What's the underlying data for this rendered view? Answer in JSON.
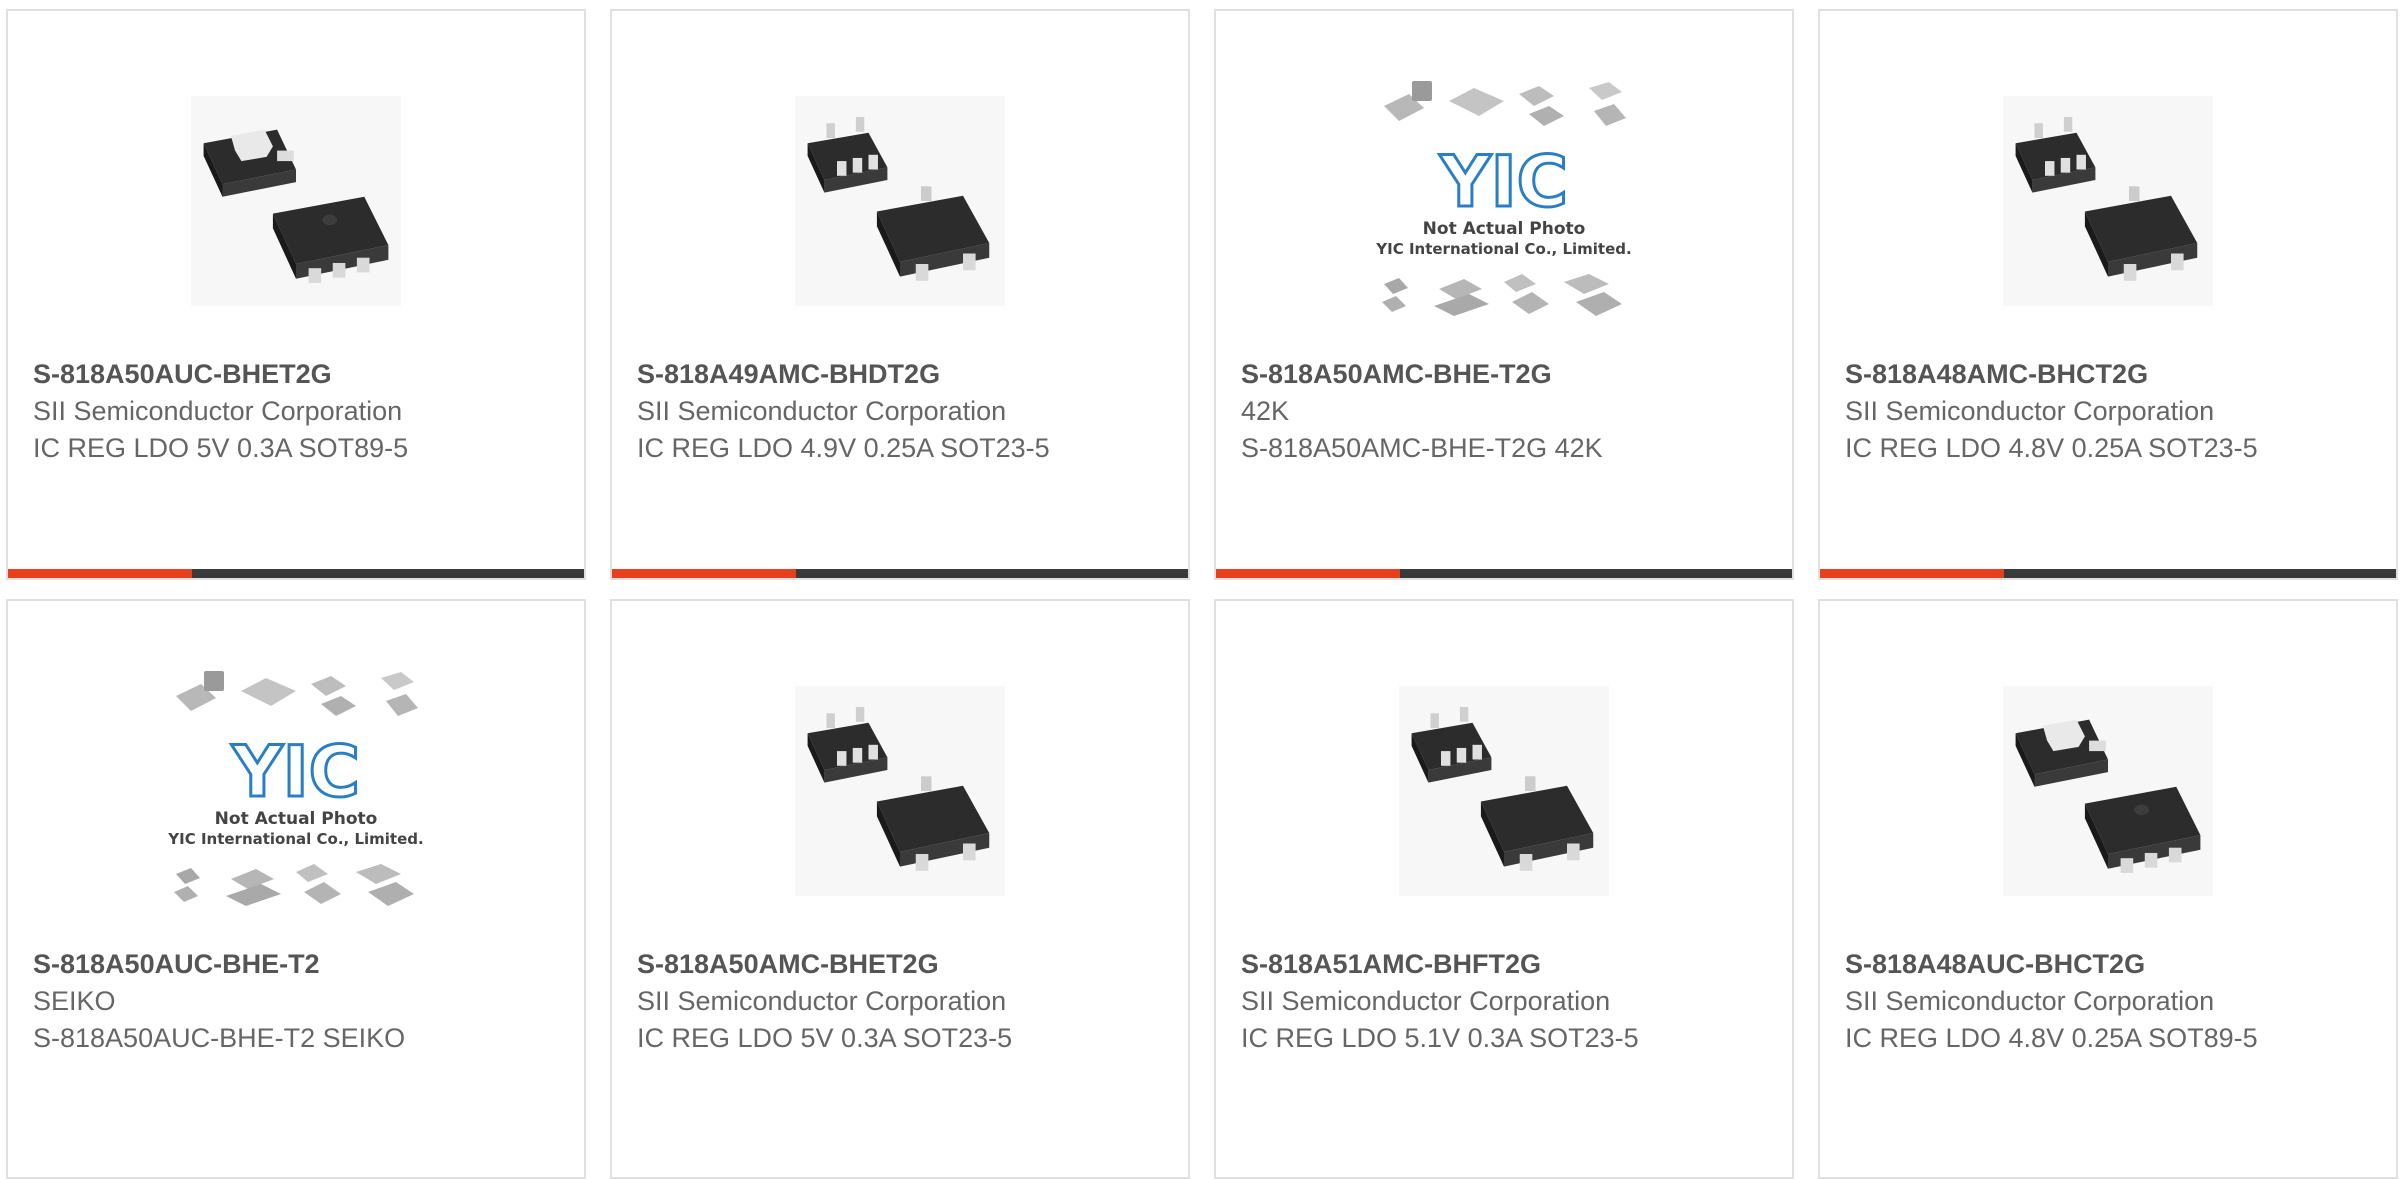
{
  "theme": {
    "accent": "#e8401c",
    "bar_dark": "#3a3a3a",
    "border": "#e0e0e0"
  },
  "products": [
    {
      "part_number": "S-818A50AUC-BHET2G",
      "manufacturer": "SII Semiconductor Corporation",
      "description": "IC REG LDO 5V 0.3A SOT89-5",
      "image": "sot89-package-photo"
    },
    {
      "part_number": "S-818A49AMC-BHDT2G",
      "manufacturer": "SII Semiconductor Corporation",
      "description": "IC REG LDO 4.9V 0.25A SOT23-5",
      "image": "sot23-package-photo"
    },
    {
      "part_number": "S-818A50AMC-BHE-T2G",
      "manufacturer": "42K",
      "description": "S-818A50AMC-BHE-T2G 42K",
      "image": "yic-not-actual-photo",
      "image_text": {
        "brand": "YIC",
        "line1": "Not Actual Photo",
        "line2": "YIC International Co., Limited."
      }
    },
    {
      "part_number": "S-818A48AMC-BHCT2G",
      "manufacturer": "SII Semiconductor Corporation",
      "description": "IC REG LDO 4.8V 0.25A SOT23-5",
      "image": "sot23-package-photo"
    },
    {
      "part_number": "S-818A50AUC-BHE-T2",
      "manufacturer": "SEIKO",
      "description": "S-818A50AUC-BHE-T2 SEIKO",
      "image": "yic-not-actual-photo",
      "image_text": {
        "brand": "YIC",
        "line1": "Not Actual Photo",
        "line2": "YIC International Co., Limited."
      }
    },
    {
      "part_number": "S-818A50AMC-BHET2G",
      "manufacturer": "SII Semiconductor Corporation",
      "description": "IC REG LDO 5V 0.3A SOT23-5",
      "image": "sot23-package-photo"
    },
    {
      "part_number": "S-818A51AMC-BHFT2G",
      "manufacturer": "SII Semiconductor Corporation",
      "description": "IC REG LDO 5.1V 0.3A SOT23-5",
      "image": "sot23-package-photo"
    },
    {
      "part_number": "S-818A48AUC-BHCT2G",
      "manufacturer": "SII Semiconductor Corporation",
      "description": "IC REG LDO 4.8V 0.25A SOT89-5",
      "image": "sot89-package-photo"
    }
  ]
}
